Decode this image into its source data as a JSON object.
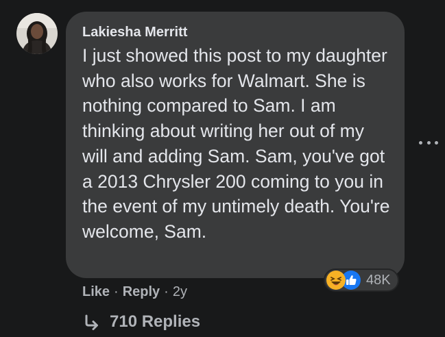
{
  "comment": {
    "author": "Lakiesha Merritt",
    "text": "I just showed this post to my daughter who also works for Walmart. She is nothing compared to Sam. I am thinking about writing her out of my will and adding Sam. Sam, you've got a 2013 Chrysler 200 coming to you in the event of my untimely death. You're welcome, Sam.",
    "avatar_icon": "user-avatar-photo"
  },
  "reactions": {
    "icons": [
      "haha-icon",
      "like-icon"
    ],
    "count": "48K"
  },
  "actions": {
    "like_label": "Like",
    "separator": "·",
    "reply_label": "Reply",
    "time": "2y"
  },
  "replies": {
    "label": "710 Replies",
    "icon": "reply-arrow-icon"
  },
  "colors": {
    "background": "#18191a",
    "bubble": "#3a3b3c",
    "primary_text": "#e4e6eb",
    "secondary_text": "#b0b3b8",
    "like_blue": "#1877f2",
    "haha_yellow": "#f7b125"
  }
}
